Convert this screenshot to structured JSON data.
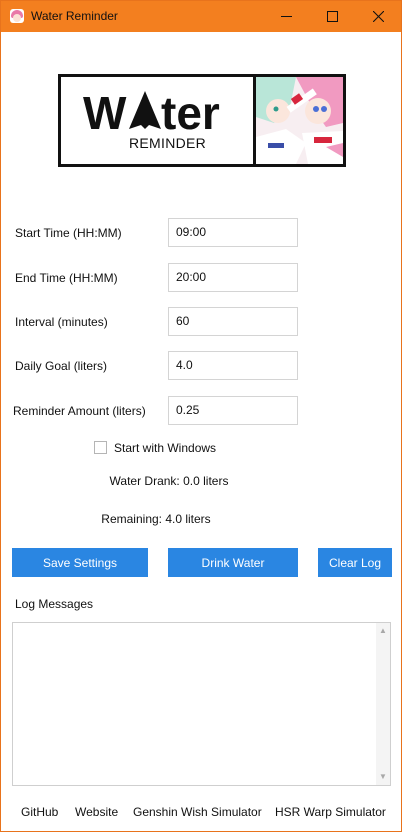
{
  "window": {
    "title": "Water Reminder",
    "controls": {
      "minimize": "minimize",
      "maximize": "maximize",
      "close": "close"
    }
  },
  "banner": {
    "logo_text": "Water",
    "logo_subtext": "REMINDER"
  },
  "form": {
    "start_time": {
      "label": "Start Time (HH:MM)",
      "value": "09:00"
    },
    "end_time": {
      "label": "End Time (HH:MM)",
      "value": "20:00"
    },
    "interval": {
      "label": "Interval (minutes)",
      "value": "60"
    },
    "daily_goal": {
      "label": "Daily Goal (liters)",
      "value": "4.0"
    },
    "reminder_amount": {
      "label": "Reminder Amount (liters)",
      "value": "0.25"
    },
    "start_with_windows": {
      "label": "Start with Windows",
      "checked": false
    }
  },
  "status": {
    "water_drank": "Water Drank: 0.0 liters",
    "remaining": "Remaining: 4.0 liters"
  },
  "buttons": {
    "save": "Save Settings",
    "drink": "Drink Water",
    "clear": "Clear Log"
  },
  "log": {
    "title": "Log Messages",
    "content": ""
  },
  "footer_links": {
    "github": "GitHub",
    "website": "Website",
    "genshin": "Genshin Wish Simulator",
    "hsr": "HSR Warp Simulator"
  },
  "colors": {
    "titlebar": "#f37f1f",
    "button": "#2a86e2"
  }
}
